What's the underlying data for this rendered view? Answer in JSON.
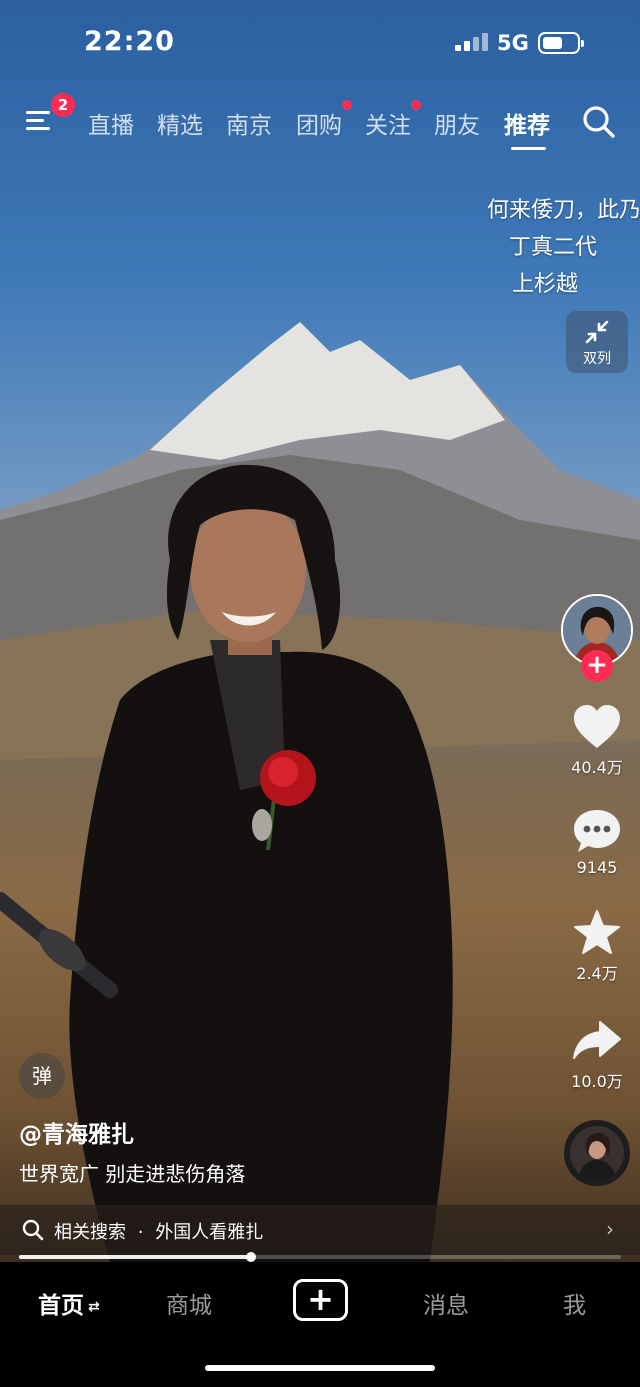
{
  "status_bar": {
    "time": "22:20",
    "network": "5G",
    "battery_level": 0.6
  },
  "top_nav": {
    "menu_badge": "2",
    "tabs": [
      {
        "label": "直播",
        "active": false,
        "dot": false
      },
      {
        "label": "精选",
        "active": false,
        "dot": false
      },
      {
        "label": "南京",
        "active": false,
        "dot": false
      },
      {
        "label": "团购",
        "active": false,
        "dot": true
      },
      {
        "label": "关注",
        "active": false,
        "dot": true
      },
      {
        "label": "朋友",
        "active": false,
        "dot": false
      },
      {
        "label": "推荐",
        "active": true,
        "dot": false
      }
    ]
  },
  "video": {
    "captions": [
      "何来倭刀，此乃",
      "丁真二代",
      "上杉越"
    ],
    "dual_column_label": "双列",
    "danmaku_label": "弹",
    "author": "@青海雅扎",
    "description": "世界宽广 别走进悲伤角落",
    "progress": 0.385
  },
  "actions": {
    "likes": "40.4万",
    "comments": "9145",
    "favorites": "2.4万",
    "shares": "10.0万"
  },
  "related_search": {
    "label": "相关搜索",
    "separator": "·",
    "query": "外国人看雅扎"
  },
  "bottom_tabs": {
    "home": "首页",
    "mall": "商城",
    "create": "+",
    "messages": "消息",
    "me": "我"
  },
  "colors": {
    "accent": "#fe2c55",
    "tabbar": "#000000"
  }
}
